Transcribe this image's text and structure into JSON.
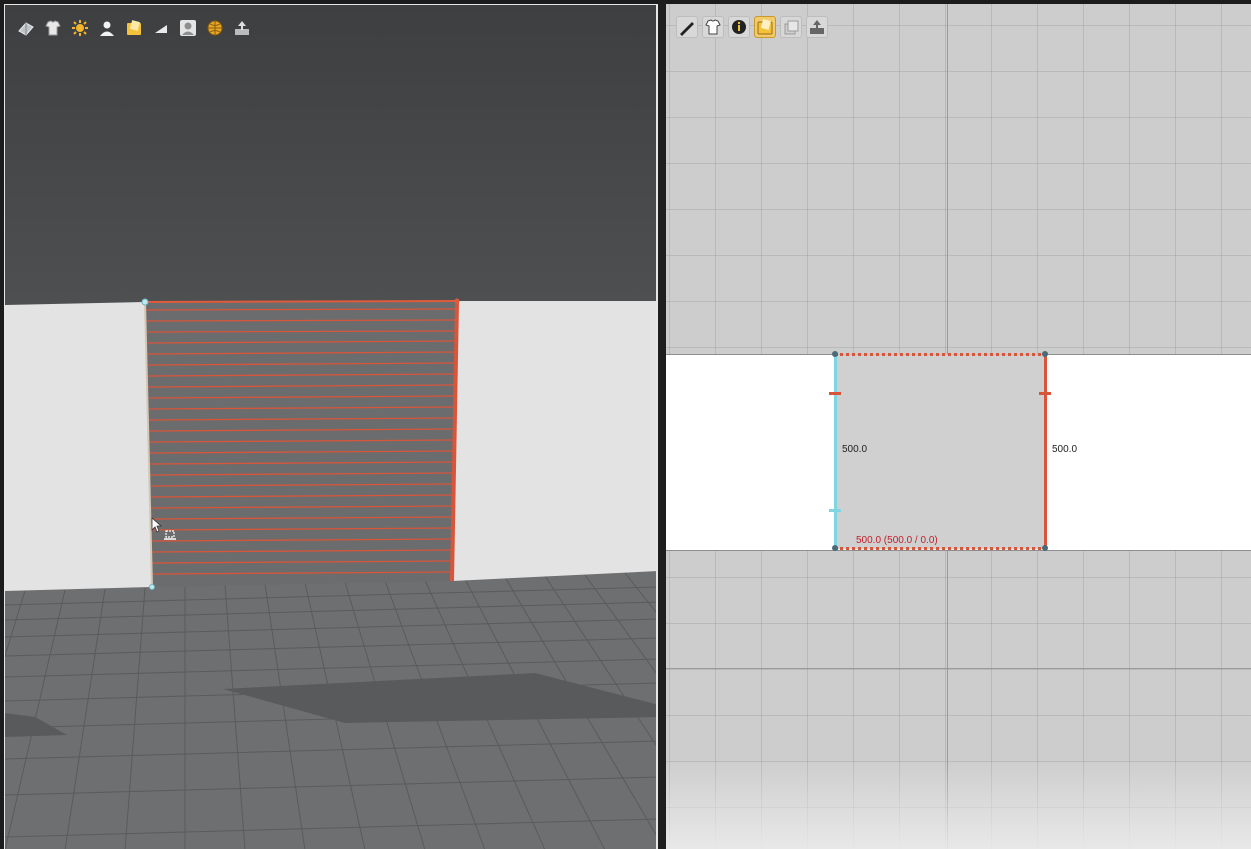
{
  "viewport_3d": {
    "toolbar": [
      {
        "name": "view-cube-icon"
      },
      {
        "name": "clothing-icon"
      },
      {
        "name": "sun-light-icon"
      },
      {
        "name": "avatar-icon"
      },
      {
        "name": "folder-icon"
      },
      {
        "name": "corner-icon"
      },
      {
        "name": "profile-icon"
      },
      {
        "name": "globe-icon"
      },
      {
        "name": "export-icon"
      }
    ]
  },
  "viewport_2d": {
    "toolbar": [
      {
        "name": "pen-tool-icon",
        "active": false
      },
      {
        "name": "garment-icon",
        "active": false
      },
      {
        "name": "info-icon",
        "active": false
      },
      {
        "name": "folder-icon",
        "active": true
      },
      {
        "name": "layers-icon",
        "active": false
      },
      {
        "name": "export-icon",
        "active": false
      }
    ],
    "dimensions": {
      "left_height": "500.0",
      "right_height": "500.0",
      "bottom_width": "500.0 (500.0 / 0.0)"
    }
  },
  "colors": {
    "selected_edge": "#d9553a",
    "cyan_edge": "#7fd6e3",
    "wall": "#e2e2e2",
    "floor": "#6a6b6c"
  }
}
